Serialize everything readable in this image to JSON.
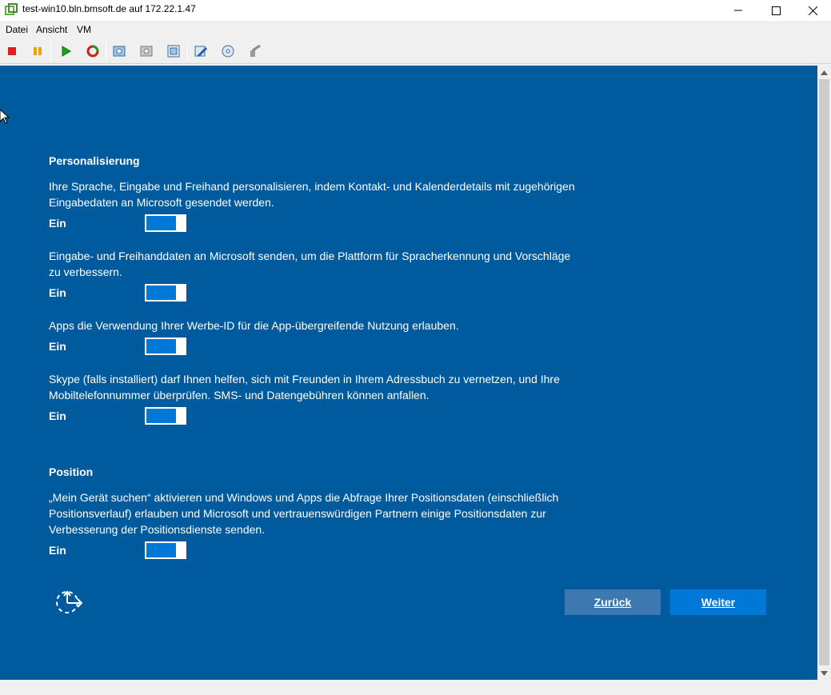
{
  "window": {
    "title": "test-win10.bln.bmsoft.de auf 172.22.1.47"
  },
  "menu": {
    "items": [
      {
        "label": "Datei"
      },
      {
        "label": "Ansicht"
      },
      {
        "label": "VM"
      }
    ]
  },
  "toolbar": {
    "buttons": [
      {
        "icon": "stop-icon"
      },
      {
        "icon": "pause-icon"
      },
      {
        "icon": "play-icon"
      },
      {
        "icon": "reset-icon"
      },
      {
        "icon": "snapshot-icon"
      },
      {
        "icon": "revert-snapshot-icon"
      },
      {
        "icon": "snapshot-manager-icon"
      },
      {
        "icon": "edit-settings-icon"
      },
      {
        "icon": "cd-dvd-icon"
      },
      {
        "icon": "tools-icon"
      }
    ]
  },
  "setup": {
    "personalization": {
      "title": "Personalisierung",
      "items": [
        {
          "text": "Ihre Sprache, Eingabe und Freihand personalisieren, indem Kontakt- und Kalenderdetails mit zugehörigen Eingabedaten an Microsoft gesendet werden.",
          "state": "Ein",
          "on": true
        },
        {
          "text": "Eingabe- und Freihanddaten an Microsoft senden, um die Plattform für Spracherkennung und Vorschläge zu verbessern.",
          "state": "Ein",
          "on": true
        },
        {
          "text": "Apps die Verwendung Ihrer Werbe-ID für die App-übergreifende Nutzung erlauben.",
          "state": "Ein",
          "on": true
        },
        {
          "text": "Skype (falls installiert) darf Ihnen helfen, sich mit Freunden in Ihrem Adressbuch zu vernetzen, und Ihre Mobiltelefonnummer überprüfen. SMS- und Datengebühren können anfallen.",
          "state": "Ein",
          "on": true
        }
      ]
    },
    "position": {
      "title": "Position",
      "items": [
        {
          "text": "„Mein Gerät suchen“ aktivieren und Windows und Apps die Abfrage Ihrer Positionsdaten (einschließlich Positionsverlauf) erlauben und Microsoft und vertrauenswürdigen Partnern einige Positionsdaten zur Verbesserung der Positionsdienste senden.",
          "state": "Ein",
          "on": true
        }
      ]
    },
    "buttons": {
      "back": "Zurück",
      "next": "Weiter"
    }
  },
  "colors": {
    "background": "#005a9e",
    "accent": "#0078d7",
    "back_button": "#3d78b0"
  }
}
